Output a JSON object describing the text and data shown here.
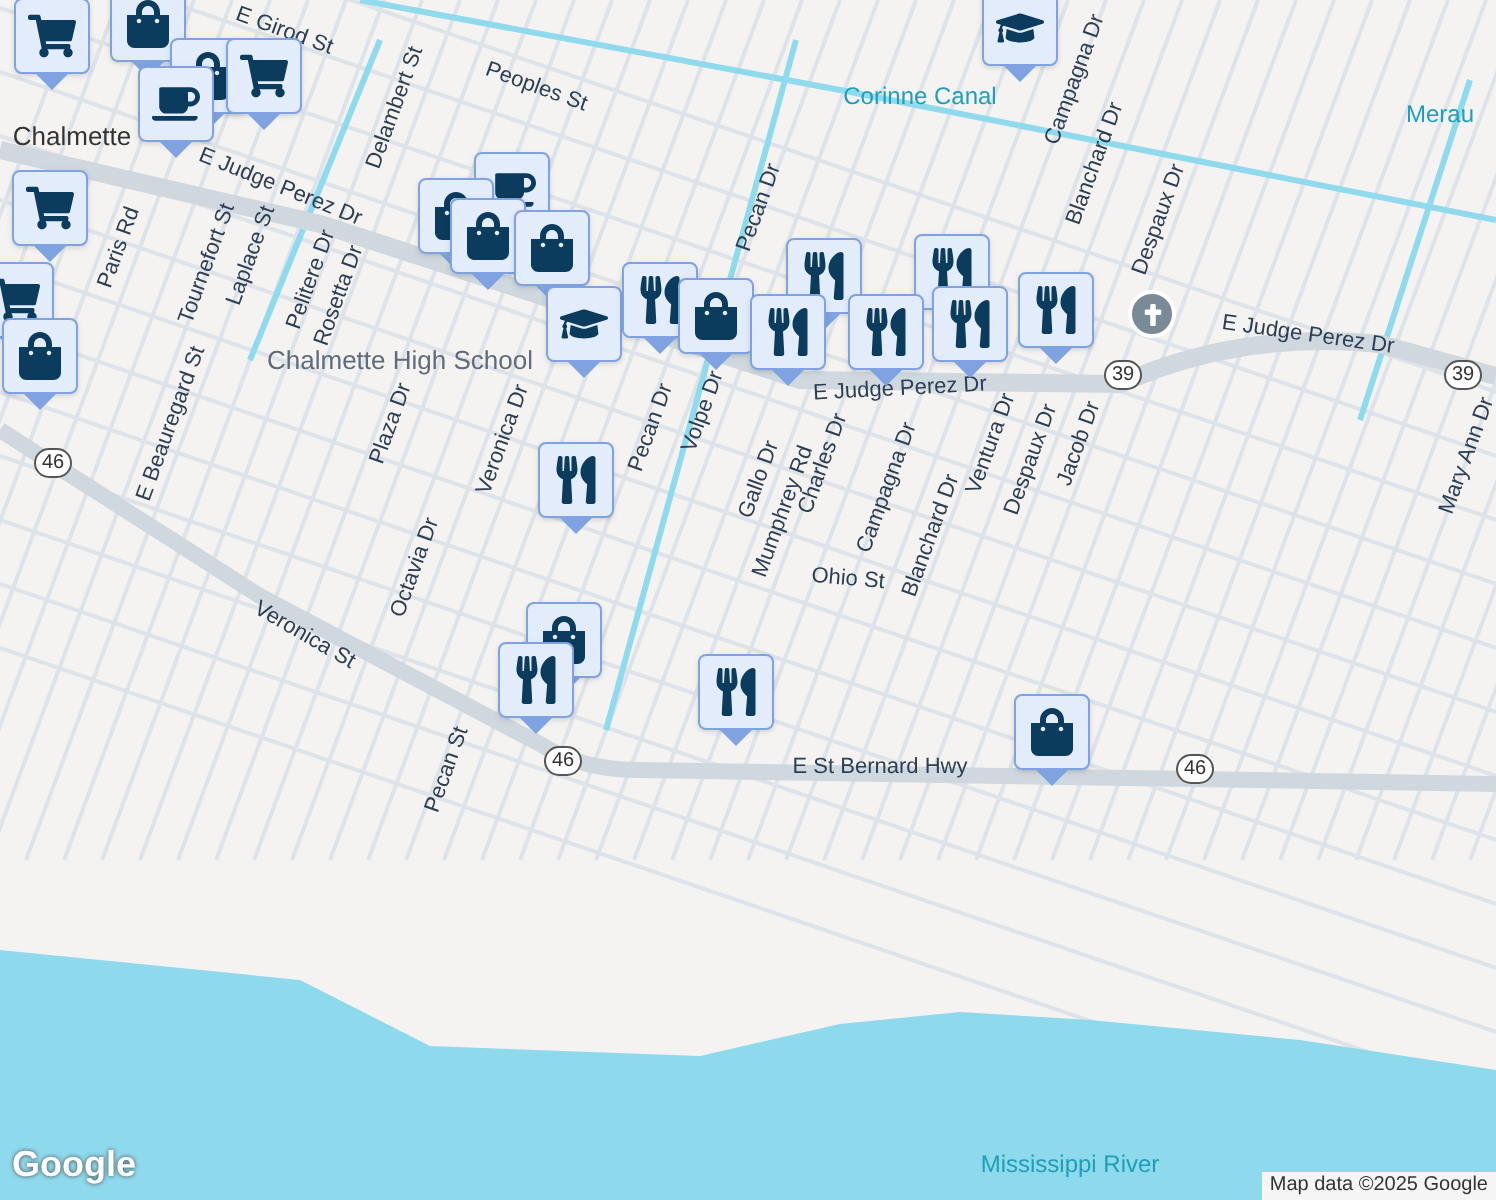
{
  "labels": [
    {
      "text": "Chalmette",
      "kind": "city"
    },
    {
      "text": "E Girod St",
      "kind": "street"
    },
    {
      "text": "Paris Rd",
      "kind": "street"
    },
    {
      "text": "E Judge Perez Dr",
      "kind": "street"
    },
    {
      "text": "Delambert St",
      "kind": "street"
    },
    {
      "text": "Tournefort St",
      "kind": "street"
    },
    {
      "text": "Laplace St",
      "kind": "street"
    },
    {
      "text": "Pelitere Dr",
      "kind": "street"
    },
    {
      "text": "Rosetta Dr",
      "kind": "street"
    },
    {
      "text": "E Beauregard St",
      "kind": "street"
    },
    {
      "text": "Peoples St",
      "kind": "street"
    },
    {
      "text": "Chalmette High School",
      "kind": "place"
    },
    {
      "text": "Plaza Dr",
      "kind": "street"
    },
    {
      "text": "Veronica Dr",
      "kind": "street"
    },
    {
      "text": "Octavia Dr",
      "kind": "street"
    },
    {
      "text": "Veronica St",
      "kind": "street"
    },
    {
      "text": "Pecan Dr",
      "kind": "street"
    },
    {
      "text": "Volpe Dr",
      "kind": "street"
    },
    {
      "text": "Pecan Dr",
      "kind": "street"
    },
    {
      "text": "Corinne Canal",
      "kind": "water"
    },
    {
      "text": "Campagna Dr",
      "kind": "street"
    },
    {
      "text": "Blanchard Dr",
      "kind": "street"
    },
    {
      "text": "Despaux Dr",
      "kind": "street"
    },
    {
      "text": "Merau",
      "kind": "water"
    },
    {
      "text": "E Judge Perez Dr",
      "kind": "street"
    },
    {
      "text": "Gallo Dr",
      "kind": "street"
    },
    {
      "text": "Mumphrey Rd",
      "kind": "street"
    },
    {
      "text": "Charles Dr",
      "kind": "street"
    },
    {
      "text": "Campagna Dr",
      "kind": "street"
    },
    {
      "text": "Blanchard Dr",
      "kind": "street"
    },
    {
      "text": "Ventura Dr",
      "kind": "street"
    },
    {
      "text": "Despaux Dr",
      "kind": "street"
    },
    {
      "text": "Jacob Dr",
      "kind": "street"
    },
    {
      "text": "E Judge Perez Dr",
      "kind": "street"
    },
    {
      "text": "Mary Ann Dr",
      "kind": "street"
    },
    {
      "text": "Ohio St",
      "kind": "street"
    },
    {
      "text": "Pecan St",
      "kind": "street"
    },
    {
      "text": "E St Bernard Hwy",
      "kind": "street"
    },
    {
      "text": "Mississippi River",
      "kind": "water"
    }
  ],
  "shields": [
    {
      "text": "46"
    },
    {
      "text": "46"
    },
    {
      "text": "46"
    },
    {
      "text": "39"
    },
    {
      "text": "39"
    }
  ],
  "markers": [
    {
      "kind": "grocery"
    },
    {
      "kind": "shop"
    },
    {
      "kind": "shop"
    },
    {
      "kind": "grocery"
    },
    {
      "kind": "cafe"
    },
    {
      "kind": "grocery"
    },
    {
      "kind": "grocery"
    },
    {
      "kind": "shop"
    },
    {
      "kind": "cafe"
    },
    {
      "kind": "shop"
    },
    {
      "kind": "shop"
    },
    {
      "kind": "shop"
    },
    {
      "kind": "school"
    },
    {
      "kind": "restaurant"
    },
    {
      "kind": "shop"
    },
    {
      "kind": "restaurant"
    },
    {
      "kind": "restaurant"
    },
    {
      "kind": "restaurant"
    },
    {
      "kind": "restaurant"
    },
    {
      "kind": "restaurant"
    },
    {
      "kind": "restaurant"
    },
    {
      "kind": "school"
    },
    {
      "kind": "church"
    },
    {
      "kind": "restaurant"
    },
    {
      "kind": "shop"
    },
    {
      "kind": "restaurant"
    },
    {
      "kind": "restaurant"
    },
    {
      "kind": "shop"
    }
  ],
  "logo": "Google",
  "attribution": "Map data ©2025 Google"
}
